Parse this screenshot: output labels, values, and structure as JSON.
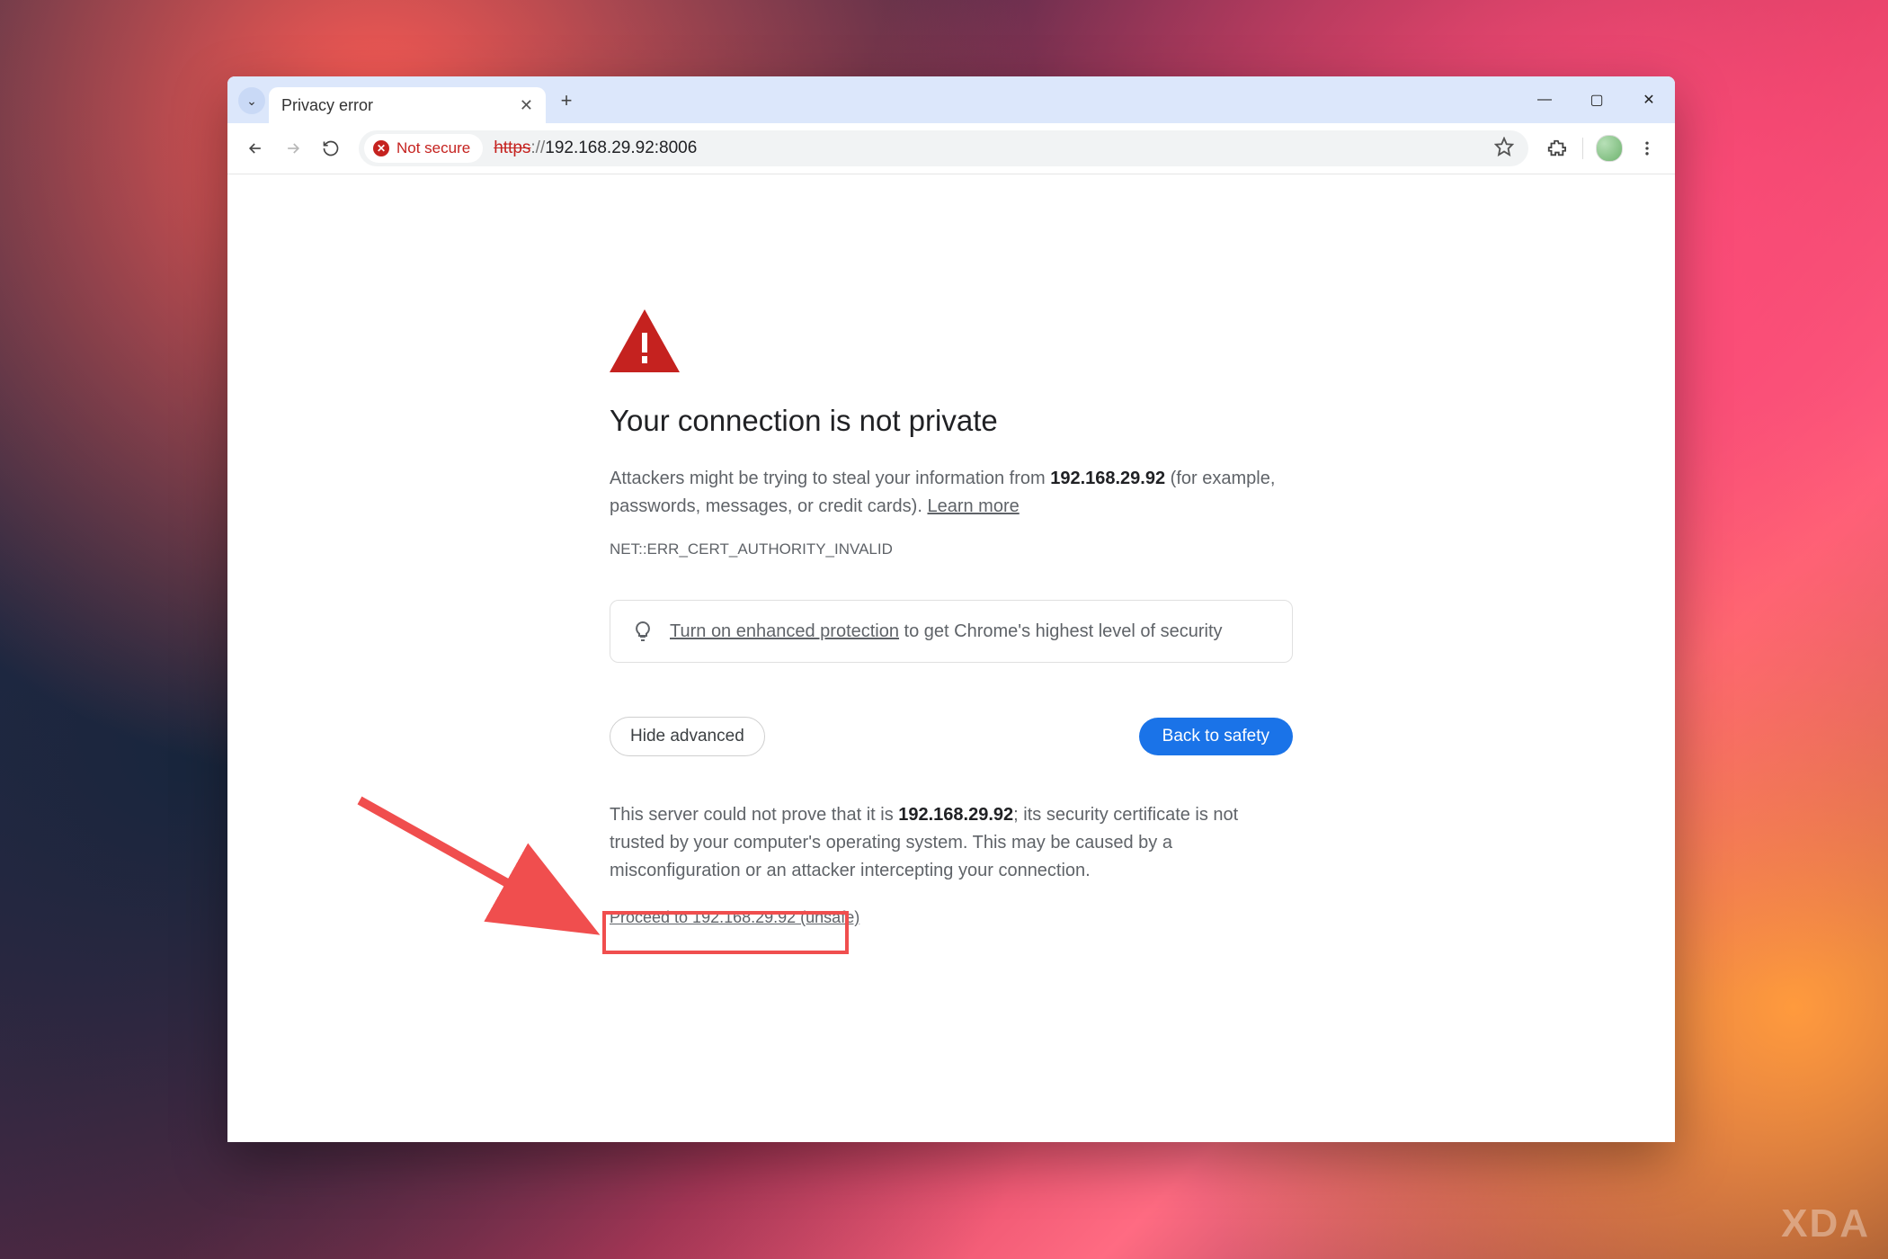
{
  "tabbar": {
    "tab_title": "Privacy error",
    "close_glyph": "✕",
    "new_tab_glyph": "+",
    "search_tabs_glyph": "⌄"
  },
  "window_controls": {
    "minimize": "—",
    "maximize": "▢",
    "close": "✕"
  },
  "toolbar": {
    "security_chip": "Not secure",
    "url_scheme": "https",
    "url_sep": "://",
    "url_rest": "192.168.29.92:8006"
  },
  "interstitial": {
    "heading": "Your connection is not private",
    "warn_before": "Attackers might be trying to steal your information from ",
    "warn_host": "192.168.29.92",
    "warn_after": " (for example, passwords, messages, or credit cards). ",
    "learn_more": "Learn more",
    "error_code": "NET::ERR_CERT_AUTHORITY_INVALID",
    "tip_link": "Turn on enhanced protection",
    "tip_rest": " to get Chrome's highest level of security",
    "hide_advanced": "Hide advanced",
    "back_to_safety": "Back to safety",
    "adv_before": "This server could not prove that it is ",
    "adv_host": "192.168.29.92",
    "adv_after": "; its security certificate is not trusted by your computer's operating system. This may be caused by a misconfiguration or an attacker intercepting your connection.",
    "proceed": "Proceed to 192.168.29.92 (unsafe)"
  },
  "watermark": "XDA",
  "colors": {
    "danger": "#c5221f",
    "primary": "#1a73e8",
    "tabstrip": "#dce7fb",
    "annotation": "#f04e4e"
  }
}
